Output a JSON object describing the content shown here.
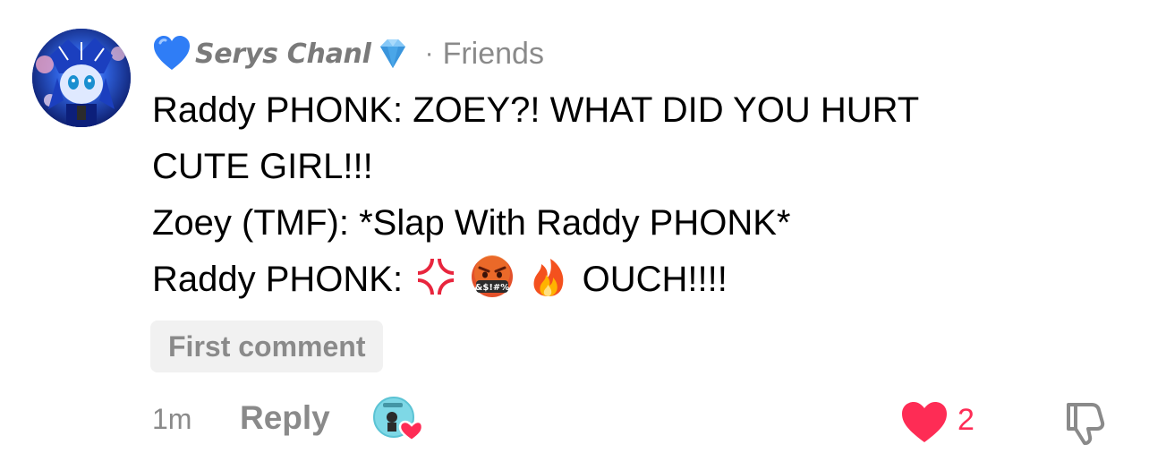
{
  "comment": {
    "author": {
      "name": "Serys Chanl",
      "prefix_emoji": "blue-heart-emoji",
      "suffix_emoji": "gem-emoji",
      "separator": "·",
      "relation": "Friends",
      "avatar_icon": "anime-avatar"
    },
    "lines": [
      {
        "text": "Raddy PHONK: ZOEY?! WHAT DID YOU HURT"
      },
      {
        "text": "CUTE GIRL!!!"
      },
      {
        "text": "Zoey (TMF): *Slap With Raddy PHONK*"
      },
      {
        "text_before": "Raddy PHONK:",
        "emojis": [
          "anger-symbol-emoji",
          "cursing-face-emoji",
          "fire-emoji"
        ],
        "text_after": "OUCH!!!!"
      }
    ],
    "badge": "First comment",
    "footer": {
      "time": "1m",
      "reply_label": "Reply",
      "creator_liked_icon": "creator-liked-avatar",
      "like_icon": "heart-icon",
      "like_count": "2",
      "dislike_icon": "thumbs-down-icon"
    },
    "colors": {
      "text_primary": "#000000",
      "text_secondary": "#8a8a8a",
      "like_active": "#fe2c55",
      "badge_bg": "#f1f1f1"
    }
  }
}
